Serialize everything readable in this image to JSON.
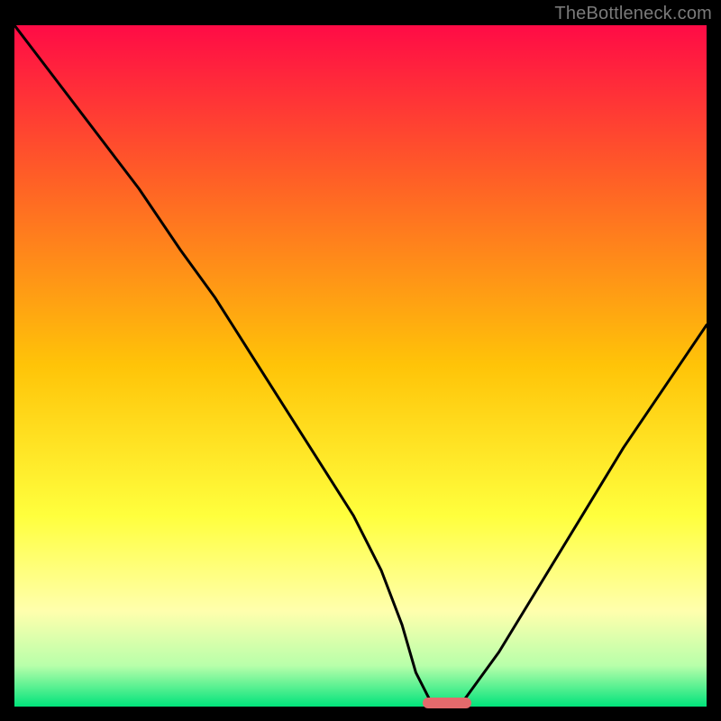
{
  "watermark": "TheBottleneck.com",
  "colors": {
    "gradient_top": "#ff0b46",
    "gradient_upper": "#ff5d27",
    "gradient_mid": "#ffc408",
    "gradient_lower": "#ffff3d",
    "gradient_pale": "#ffffad",
    "gradient_mint": "#b8ffaa",
    "gradient_green": "#01e37b",
    "curve": "#000000",
    "marker": "#e46a6c",
    "frame": "#000000"
  },
  "chart_data": {
    "type": "line",
    "title": "",
    "xlabel": "",
    "ylabel": "",
    "xlim": [
      0,
      100
    ],
    "ylim": [
      0,
      100
    ],
    "series": [
      {
        "name": "bottleneck-curve",
        "x": [
          0,
          6,
          12,
          18,
          24,
          29,
          34,
          39,
          44,
          49,
          53,
          56,
          58,
          60,
          62,
          64,
          65,
          70,
          76,
          82,
          88,
          94,
          100
        ],
        "y": [
          100,
          92,
          84,
          76,
          67,
          60,
          52,
          44,
          36,
          28,
          20,
          12,
          5,
          1,
          0,
          0,
          1,
          8,
          18,
          28,
          38,
          47,
          56
        ]
      }
    ],
    "annotations": [
      {
        "name": "optimal-range-marker",
        "x_start": 59,
        "x_end": 66,
        "y": 0.5
      }
    ]
  }
}
